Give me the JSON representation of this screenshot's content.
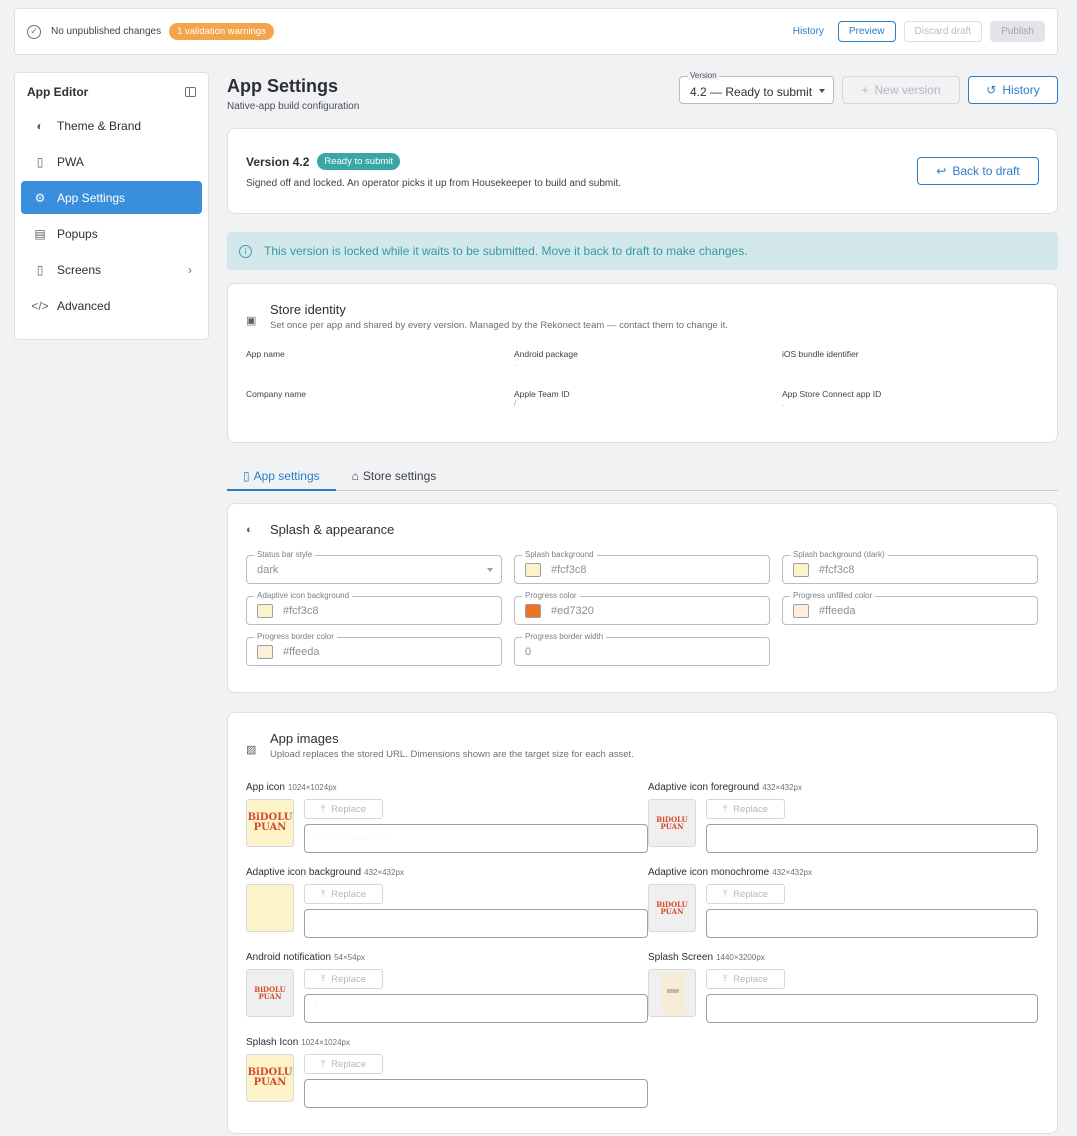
{
  "topbar": {
    "status": "No unpublished changes",
    "warning_badge": "1 validation warnings",
    "history": "History",
    "preview": "Preview",
    "discard": "Discard draft",
    "publish": "Publish"
  },
  "sidebar": {
    "title": "App Editor",
    "items": [
      {
        "label": "Theme & Brand",
        "icon": "palette-icon"
      },
      {
        "label": "PWA",
        "icon": "mobile-app-icon"
      },
      {
        "label": "App Settings",
        "icon": "gear-icon",
        "active": true
      },
      {
        "label": "Popups",
        "icon": "message-icon"
      },
      {
        "label": "Screens",
        "icon": "phone-icon",
        "has_children": true
      },
      {
        "label": "Advanced",
        "icon": "code-icon"
      }
    ]
  },
  "header": {
    "title": "App Settings",
    "subtitle": "Native-app build configuration",
    "version_label": "Version",
    "version_value": "4.2 — Ready to submit",
    "new_version": "New version",
    "history": "History"
  },
  "version_card": {
    "title": "Version 4.2",
    "badge": "Ready to submit",
    "description": "Signed off and locked. An operator picks it up from Housekeeper to build and submit.",
    "back_button": "Back to draft"
  },
  "info_banner": "This version is locked while it waits to be submitted. Move it back to draft to make changes.",
  "store_identity": {
    "title": "Store identity",
    "subtitle": "Set once per app and shared by every version. Managed by the Rekonect team — contact them to change it.",
    "fields": [
      {
        "label": "App name",
        "value": ""
      },
      {
        "label": "Android package",
        "value": "."
      },
      {
        "label": "iOS bundle identifier",
        "value": ""
      },
      {
        "label": "Company name",
        "value": ""
      },
      {
        "label": "Apple Team ID",
        "value": "/"
      },
      {
        "label": "App Store Connect app ID",
        "value": "."
      }
    ]
  },
  "tabs": [
    {
      "label": "App settings",
      "active": true
    },
    {
      "label": "Store settings",
      "active": false
    }
  ],
  "splash": {
    "title": "Splash & appearance",
    "fields": [
      {
        "label": "Status bar style",
        "value": "dark",
        "type": "select"
      },
      {
        "label": "Splash background",
        "value": "#fcf3c8",
        "color": "#fcf3c8"
      },
      {
        "label": "Splash background (dark)",
        "value": "#fcf3c8",
        "color": "#fcf3c8"
      },
      {
        "label": "Adaptive icon background",
        "value": "#fcf3c8",
        "color": "#fcf3c8"
      },
      {
        "label": "Progress color",
        "value": "#ed7320",
        "color": "#ed7320"
      },
      {
        "label": "Progress unfilled color",
        "value": "#ffeeda",
        "color": "#ffeeda"
      },
      {
        "label": "Progress border color",
        "value": "#ffeeda",
        "color": "#ffeeda"
      },
      {
        "label": "Progress border width",
        "value": "0",
        "type": "number"
      }
    ]
  },
  "images": {
    "title": "App images",
    "subtitle": "Upload replaces the stored URL. Dimensions shown are the target size for each asset.",
    "replace_label": "Replace",
    "logo_text": "BiDOLU PUAN",
    "items": [
      {
        "label": "App icon",
        "dim": "1024×1024px",
        "thumb": "logo-big",
        "url": "· · ·   ·   · ·   ·   ·   · ·   ·   ·   ·   · ·   ·   ·   ·   ·   · ·"
      },
      {
        "label": "Adaptive icon foreground",
        "dim": "432×432px",
        "thumb": "logo-small",
        "url": ""
      },
      {
        "label": "Adaptive icon background",
        "dim": "432×432px",
        "thumb": "plain",
        "url": ""
      },
      {
        "label": "Adaptive icon monochrome",
        "dim": "432×432px",
        "thumb": "logo-small",
        "url": ""
      },
      {
        "label": "Android notification",
        "dim": "54×54px",
        "thumb": "logo-gray",
        "url": "'"
      },
      {
        "label": "Splash Screen",
        "dim": "1440×3200px",
        "thumb": "phone",
        "url": ""
      },
      {
        "label": "Splash Icon",
        "dim": "1024×1024px",
        "thumb": "logo-big",
        "url": ""
      }
    ]
  }
}
